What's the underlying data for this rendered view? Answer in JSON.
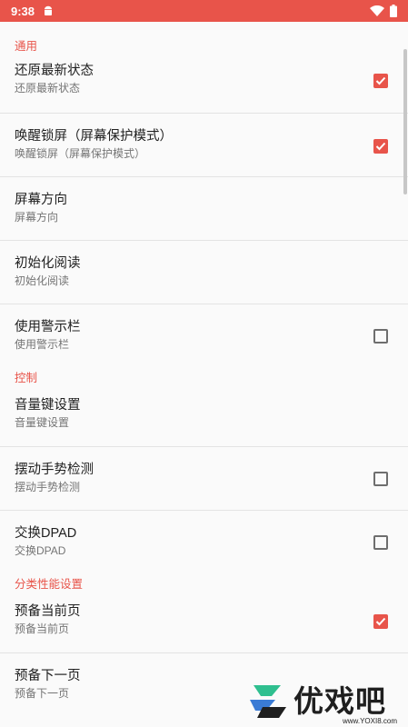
{
  "status_bar": {
    "time": "9:38",
    "android_icon": "android-icon",
    "wifi_icon": "wifi-icon",
    "battery_icon": "battery-icon"
  },
  "colors": {
    "accent": "#e8544a",
    "text": "#212121",
    "summary": "#757575",
    "divider": "#e3e3e3",
    "checkbox_off": "#6e6e6e"
  },
  "sections": {
    "general": {
      "header": "通用",
      "items": [
        {
          "title": "还原最新状态",
          "summary": "还原最新状态",
          "checkbox": true,
          "checked": true
        },
        {
          "title": "唤醒锁屏（屏幕保护模式）",
          "summary": "唤醒锁屏（屏幕保护模式）",
          "checkbox": true,
          "checked": true
        },
        {
          "title": "屏幕方向",
          "summary": "屏幕方向",
          "checkbox": false
        },
        {
          "title": "初始化阅读",
          "summary": "初始化阅读",
          "checkbox": false
        },
        {
          "title": "使用警示栏",
          "summary": "使用警示栏",
          "checkbox": true,
          "checked": false
        }
      ]
    },
    "control": {
      "header": "控制",
      "items": [
        {
          "title": "音量键设置",
          "summary": "音量键设置",
          "checkbox": false
        },
        {
          "title": "摆动手势检测",
          "summary": "摆动手势检测",
          "checkbox": true,
          "checked": false
        },
        {
          "title": "交换DPAD",
          "summary": "交换DPAD",
          "checkbox": true,
          "checked": false
        }
      ]
    },
    "performance": {
      "header": "分类性能设置",
      "items": [
        {
          "title": "预备当前页",
          "summary": "预备当前页",
          "checkbox": true,
          "checked": true
        },
        {
          "title": "预备下一页",
          "summary": "预备下一页",
          "checkbox": false
        }
      ]
    }
  },
  "watermark": {
    "text": "优戏吧",
    "sub": "www.YOXI8.com",
    "icon": "yoxi8-logo-icon"
  }
}
